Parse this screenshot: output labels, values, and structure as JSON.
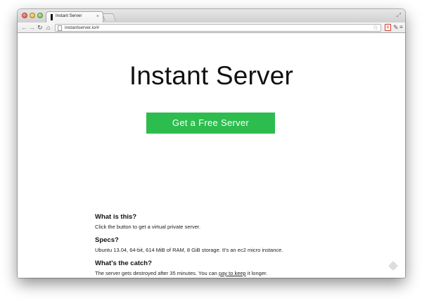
{
  "browser": {
    "tab_title": "Instant Server",
    "tab_close": "×",
    "url": "instantserver.io/#",
    "icons": {
      "back": "back-arrow-icon",
      "forward": "forward-arrow-icon",
      "reload": "reload-icon",
      "home": "home-icon",
      "star": "star-icon",
      "extension": "extension-icon",
      "wrench": "wrench-icon",
      "menu": "menu-icon"
    }
  },
  "page": {
    "title": "Instant Server",
    "cta_label": "Get a Free Server",
    "cta_color": "#2dbd4e",
    "faq": [
      {
        "question": "What is this?",
        "answer": "Click the button to get a virtual private server."
      },
      {
        "question": "Specs?",
        "answer": "Ubuntu 13.04, 64-bit, 614 MiB of RAM, 8 GiB storage. It's an ec2 micro instance."
      },
      {
        "question": "What's the catch?",
        "answer_prefix": "The server gets destroyed after 35 minutes. You can ",
        "answer_link": "pay to keep",
        "answer_suffix": " it longer."
      }
    ]
  }
}
